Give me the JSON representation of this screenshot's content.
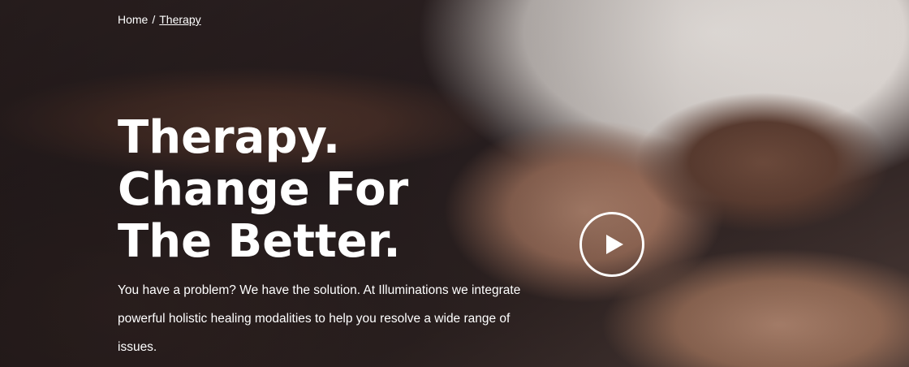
{
  "breadcrumb": {
    "home_label": "Home",
    "separator": "/",
    "current_label": "Therapy"
  },
  "hero": {
    "headline_line1": "Therapy.",
    "headline_line2": "Change For",
    "headline_line3": "The Better.",
    "intro_text": "You have a problem? We have the solution. At Illuminations we integrate powerful holistic healing modalities to help you resolve a wide range of issues.",
    "play_icon": "play-icon"
  },
  "colors": {
    "text": "#ffffff",
    "background_dark": "#2a2224"
  }
}
